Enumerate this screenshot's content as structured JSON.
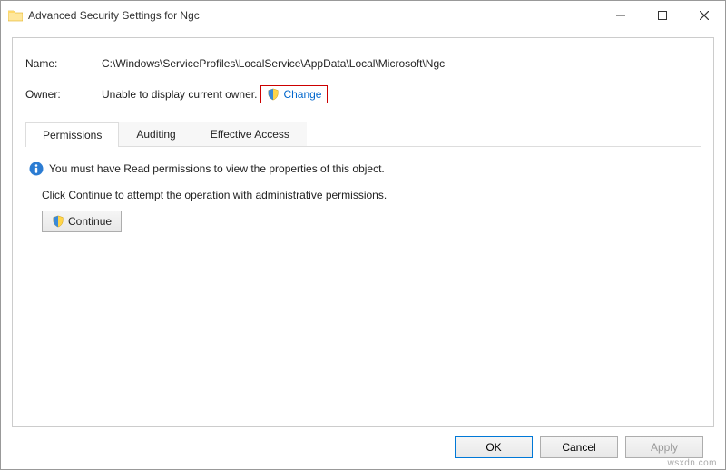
{
  "window": {
    "title": "Advanced Security Settings for Ngc"
  },
  "properties": {
    "name_label": "Name:",
    "name_value": "C:\\Windows\\ServiceProfiles\\LocalService\\AppData\\Local\\Microsoft\\Ngc",
    "owner_label": "Owner:",
    "owner_value": "Unable to display current owner.",
    "change_label": "Change"
  },
  "tabs": {
    "permissions": "Permissions",
    "auditing": "Auditing",
    "effective": "Effective Access"
  },
  "content": {
    "info_line": "You must have Read permissions to view the properties of this object.",
    "continue_line": "Click Continue to attempt the operation with administrative permissions.",
    "continue_button": "Continue"
  },
  "footer": {
    "ok": "OK",
    "cancel": "Cancel",
    "apply": "Apply"
  },
  "watermark": "wsxdn.com"
}
